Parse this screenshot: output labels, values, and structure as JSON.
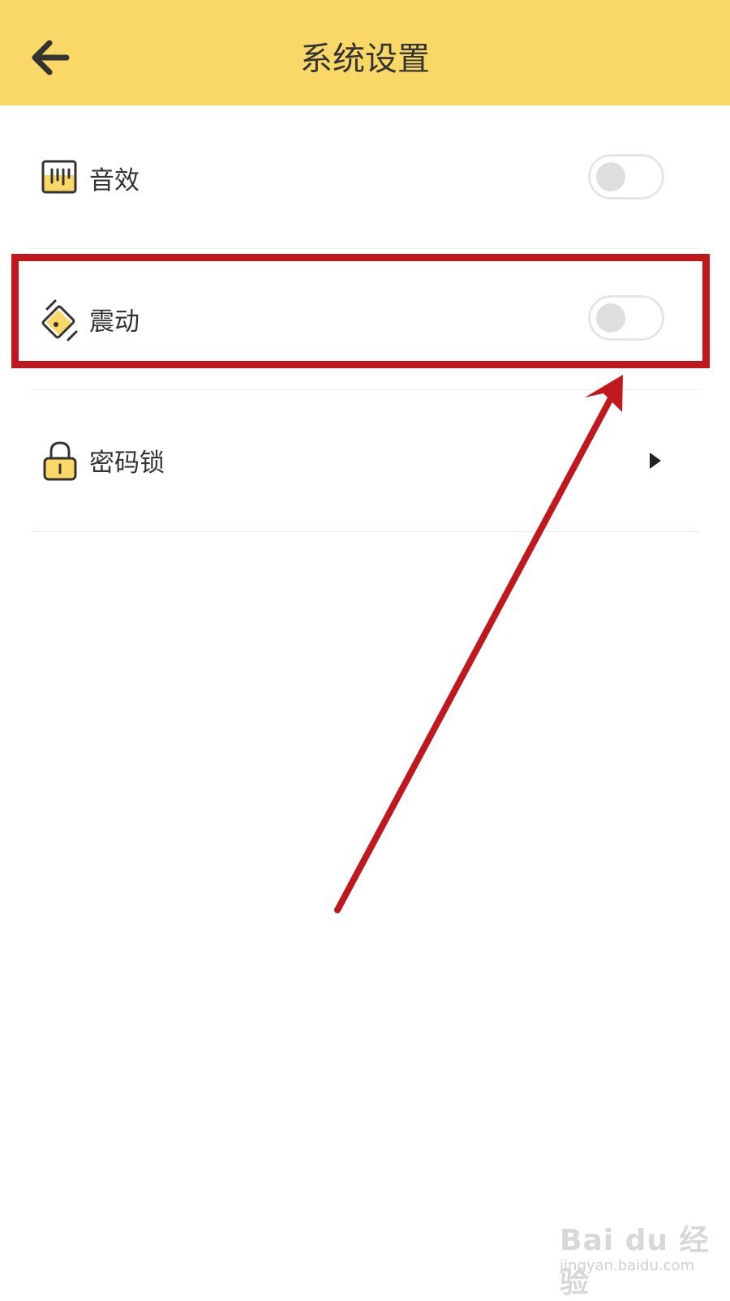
{
  "header": {
    "title": "系统设置",
    "back_icon": "arrow-left-icon",
    "background_color": "#f9d867"
  },
  "settings": [
    {
      "label": "音效",
      "icon": "sound-effect-icon",
      "control": "toggle",
      "enabled": false
    },
    {
      "label": "震动",
      "icon": "vibration-icon",
      "control": "toggle",
      "enabled": false
    },
    {
      "label": "密码锁",
      "icon": "lock-icon",
      "control": "chevron"
    }
  ],
  "annotation": {
    "highlight_color": "#c0181c",
    "highlighted_item": "震动"
  },
  "watermark": {
    "brand": "Bai du 经验",
    "url": "jingyan.baidu.com"
  }
}
